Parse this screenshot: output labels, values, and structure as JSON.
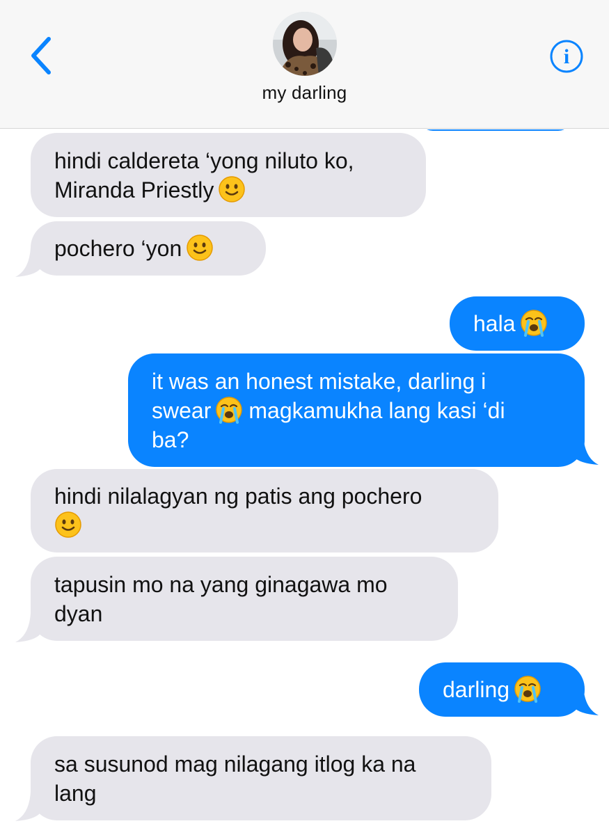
{
  "header": {
    "contact_name": "my darling"
  },
  "messages": [
    {
      "side": "received",
      "text": "hindi caldereta ‘yong niluto ko,\nMiranda Priestly",
      "emoji": "slightly-smiling-face"
    },
    {
      "side": "received",
      "text": "pochero ‘yon",
      "emoji": "slightly-smiling-face"
    },
    {
      "side": "sent",
      "text": "hala",
      "emoji": "loudly-crying-face"
    },
    {
      "side": "sent",
      "text_before": "it was an honest mistake, darling i\nswear",
      "emoji": "loudly-crying-face",
      "text_after": "magkamukha lang kasi ‘di\nba?"
    },
    {
      "side": "received",
      "text": "hindi nilalagyan ng patis ang pochero",
      "emoji": "slightly-smiling-face"
    },
    {
      "side": "received",
      "text": "tapusin mo na yang ginagawa mo\ndyan"
    },
    {
      "side": "sent",
      "text": "darling",
      "emoji": "loudly-crying-face"
    },
    {
      "side": "received",
      "text": "sa susunod mag nilagang itlog ka na\nlang"
    }
  ],
  "icons": {
    "back": "chevron-left-icon",
    "info": "info-icon"
  },
  "colors": {
    "accent": "#0a84ff",
    "received_bubble": "#e6e5eb",
    "header_bg": "#f7f7f7"
  }
}
